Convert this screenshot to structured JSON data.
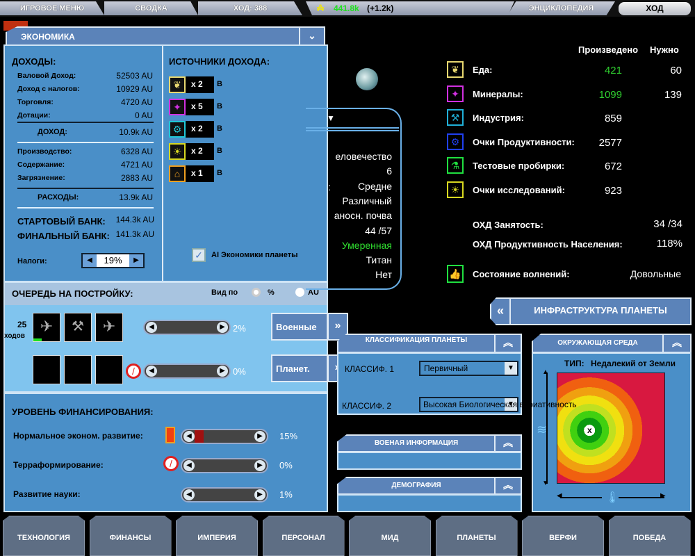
{
  "topbar": {
    "game_menu": "ИГРОВОЕ МЕНЮ",
    "summary": "СВОДКА",
    "turn": "ХОД: 388",
    "treasury": "441.8k",
    "treasury_delta": "(+1.2k)",
    "encyclopedia": "ЭНЦИКЛОПЕДИЯ",
    "end_turn": "ХОД"
  },
  "economy": {
    "title": "ЭКОНОМИКА",
    "income_header": "ДОХОДЫ:",
    "income_rows": [
      {
        "label": "Валовой Доход:",
        "value": "52503 AU"
      },
      {
        "label": "Доход с налогов:",
        "value": "10929 AU"
      },
      {
        "label": "Торговля:",
        "value": "4720 AU"
      },
      {
        "label": "Дотации:",
        "value": "0 AU"
      }
    ],
    "income_total": {
      "label": "ДОХОД:",
      "value": "10.9k AU"
    },
    "expense_rows": [
      {
        "label": "Производство:",
        "value": "6328 AU"
      },
      {
        "label": "Содержание:",
        "value": "4721 AU"
      },
      {
        "label": "Загрязнение:",
        "value": "2883 AU"
      }
    ],
    "expense_total": {
      "label": "РАСХОДЫ:",
      "value": "13.9k AU"
    },
    "start_bank": {
      "label": "СТАРТОВЫЙ БАНК:",
      "value": "144.3k AU"
    },
    "final_bank": {
      "label": "ФИНАЛЬНЫЙ БАНК:",
      "value": "141.3k AU"
    },
    "tax_label": "Налоги:",
    "tax_value": "19%",
    "sources_header": "ИСТОЧНИКИ ДОХОДА:",
    "sources": [
      {
        "icon": "wheat-icon",
        "mult": "x 2",
        "suffix": "B",
        "color": "#e8d870"
      },
      {
        "icon": "crystals-icon",
        "mult": "x 5",
        "suffix": "B",
        "color": "#d030e0"
      },
      {
        "icon": "gear-factory-icon",
        "mult": "x 2",
        "suffix": "B",
        "color": "#20c8d8"
      },
      {
        "icon": "lightbulb-icon",
        "mult": "x 2",
        "suffix": "B",
        "color": "#d8d820"
      },
      {
        "icon": "bank-icon",
        "mult": "x 1",
        "suffix": "B",
        "color": "#f0a020"
      }
    ],
    "ai_checkbox_label": "AI Экономики планеты",
    "ai_checked": true
  },
  "queue": {
    "title": "ОЧЕРЕДЬ НА ПОСТРОЙКУ:",
    "view_by": "Вид по",
    "opt_percent": "%",
    "opt_au": "AU",
    "turns_num": "25",
    "turns_label": "ходов",
    "military_pct": "2%",
    "planet_pct": "0%",
    "military_btn": "Военные",
    "planet_btn": "Планет."
  },
  "funding": {
    "title": "УРОВЕНЬ ФИНАНСИРОВАНИЯ:",
    "rows": [
      {
        "label": "Нормальное эконом. развитие:",
        "value": "15%",
        "fraction": 0.15
      },
      {
        "label": "Терраформирование:",
        "value": "0%",
        "fraction": 0
      },
      {
        "label": "Развитие науки:",
        "value": "1%",
        "fraction": 0.01
      }
    ]
  },
  "planet_info": {
    "values": [
      "еловечество",
      "6",
      "Средне",
      "Различный",
      "аносн. почва",
      "44 /57",
      "Умеренная",
      "Титан",
      "Нет"
    ],
    "highlight_color": "#30e030"
  },
  "resources": {
    "col_produced": "Произведено",
    "col_needed": "Нужно",
    "rows": [
      {
        "icon": "wheat-icon",
        "label": "Еда:",
        "produced": "421",
        "needed": "60",
        "color": "#e8d870",
        "green": true
      },
      {
        "icon": "crystals-icon",
        "label": "Минералы:",
        "produced": "1099",
        "needed": "139",
        "color": "#d030e0",
        "green": true
      },
      {
        "icon": "hammer-icon",
        "label": "Индустрия:",
        "produced": "859",
        "needed": "",
        "color": "#20b0d8"
      },
      {
        "icon": "gear-icon",
        "label": "Очки Продуктивности:",
        "produced": "2577",
        "needed": "",
        "color": "#2040f0"
      },
      {
        "icon": "flask-icon",
        "label": "Тестовые пробирки:",
        "produced": "672",
        "needed": "",
        "color": "#20e040"
      },
      {
        "icon": "lightbulb-icon",
        "label": "Очки исследований:",
        "produced": "923",
        "needed": "",
        "color": "#d8d820"
      }
    ],
    "employment": {
      "label": "ОХД Занятость:",
      "value": "34 /34"
    },
    "productivity": {
      "label": "ОХД Продуктивность Населения:",
      "value": "118%"
    },
    "unrest": {
      "label": "Состояние волнений:",
      "value": "Довольные"
    }
  },
  "infrastructure_btn": "ИНФРАСТРУКТУРА ПЛАНЕТЫ",
  "classification": {
    "title": "КЛАССИФИКАЦИЯ ПЛАНЕТЫ",
    "class1_label": "КЛАССИФ. 1",
    "class1_value": "Первичный",
    "class2_label": "КЛАССИФ. 2",
    "class2_value": "Высокая Биологическая вариативность"
  },
  "military_info_title": "ВОЕНАЯ ИНФОРМАЦИЯ",
  "demography_title": "ДЕМОГРАФИЯ",
  "environment": {
    "title": "ОКРУЖАЮЩАЯ СРЕДА",
    "type_label": "ТИП:",
    "type_value": "Недалекий от Земли"
  },
  "bottom_tabs": [
    "ТЕХНОЛОГИЯ",
    "ФИНАНСЫ",
    "ИМПЕРИЯ",
    "ПЕРСОНАЛ",
    "МИД",
    "ПЛАНЕТЫ",
    "ВЕРФИ",
    "ПОБЕДА"
  ]
}
